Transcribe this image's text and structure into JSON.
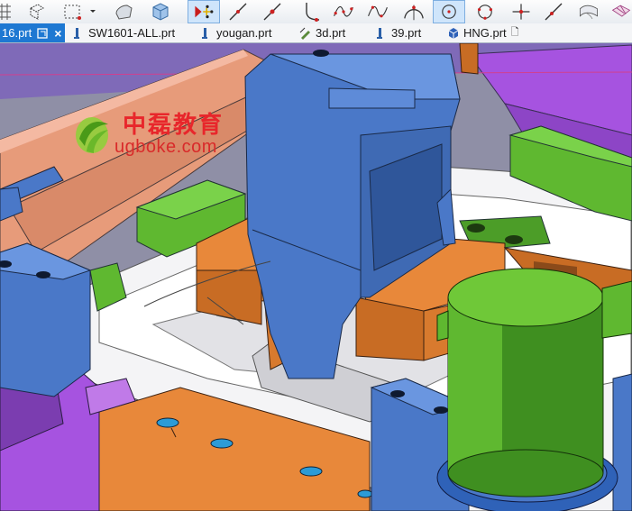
{
  "toolbar": {
    "icons": [
      "grid-view-icon",
      "sketch-plane-icon",
      "dashed-frame-icon",
      "dropdown-arrow-icon",
      "extrude-icon",
      "box-icon",
      "point-set-icon",
      "line-icon",
      "two-point-line-icon",
      "fillet-curve-icon",
      "spline-icon",
      "studio-spline-icon",
      "arc-icon",
      "circle-icon",
      "circle-points-icon",
      "cross-point-icon",
      "angled-line-icon",
      "surface-icon",
      "wire-surface-icon"
    ],
    "active_icons": [
      "point-set-icon",
      "circle-icon"
    ]
  },
  "tabs": [
    {
      "label": "16.prt",
      "icon": "part-file-icon",
      "active": true,
      "modified_icon": "window-icon",
      "close": "×"
    },
    {
      "label": "SW1601-ALL.prt",
      "icon": "assembly-file-icon",
      "active": false
    },
    {
      "label": "yougan.prt",
      "icon": "assembly-file-icon",
      "active": false
    },
    {
      "label": "3d.prt",
      "icon": "drafting-file-icon",
      "active": false
    },
    {
      "label": "39.prt",
      "icon": "assembly-file-icon",
      "active": false
    },
    {
      "label": "HNG.prt",
      "icon": "cube-file-icon",
      "active": false,
      "tail": "🗋"
    }
  ],
  "watermark": {
    "title": "中磊教育",
    "url": "ugboke.com"
  },
  "colors": {
    "tab_active": "#1e78d2",
    "mold_blue": "#4a78c8",
    "mold_orange": "#e8883a",
    "mold_green": "#5fb830",
    "mold_purple": "#a653e0",
    "mold_salmon": "#e79b7a",
    "watermark_red": "#e8262b"
  }
}
